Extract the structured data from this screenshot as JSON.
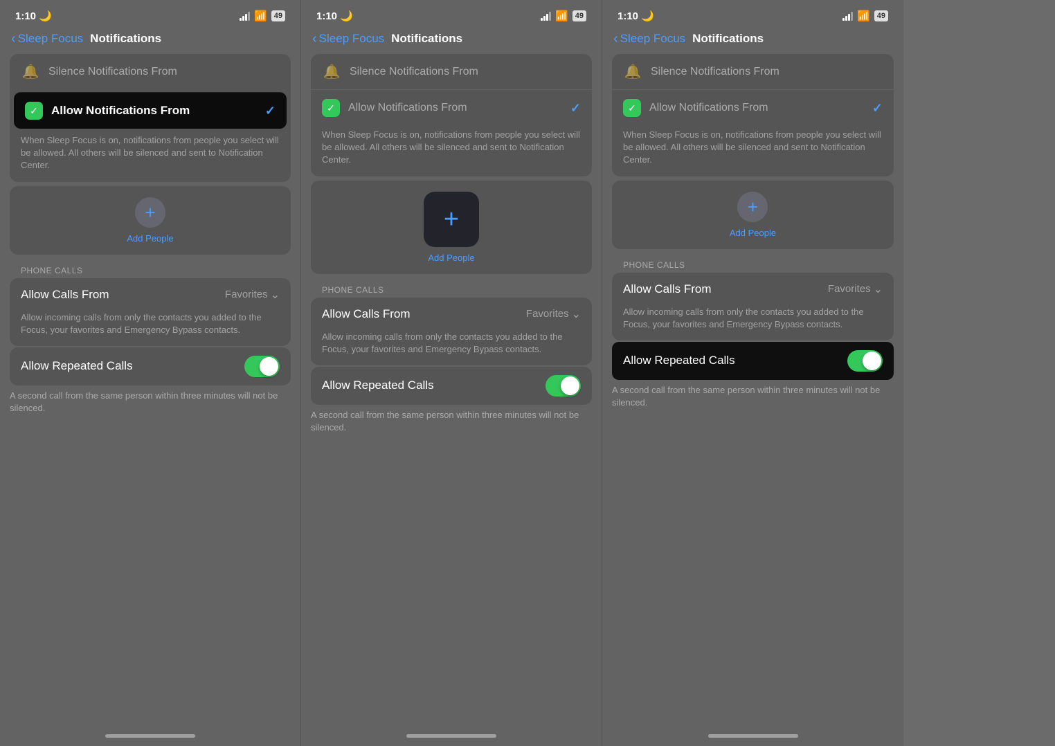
{
  "panels": [
    {
      "id": "panel-1",
      "statusBar": {
        "time": "1:10",
        "moonIcon": "🌙",
        "battery": "49"
      },
      "nav": {
        "backLabel": "Sleep Focus",
        "title": "Notifications"
      },
      "silenceLabel": "Silence Notifications From",
      "allowLabel": "Allow Notifications From",
      "allowSelected": true,
      "description": "When Sleep Focus is on, notifications from people you select will be allowed. All others will be silenced and sent to Notification Center.",
      "addPeopleLabel": "Add People",
      "addPeopleHighlighted": false,
      "phoneCallsHeader": "PHONE CALLS",
      "allowCallsLabel": "Allow Calls From",
      "allowCallsValue": "Favorites",
      "callsDescription": "Allow incoming calls from only the contacts you added to the Focus, your favorites and Emergency Bypass contacts.",
      "allowRepeatedLabel": "Allow Repeated Calls",
      "toggleOn": true,
      "toggleHighlighted": false,
      "repeatedDesc": "A second call from the same person within three minutes will not be silenced."
    },
    {
      "id": "panel-2",
      "statusBar": {
        "time": "1:10",
        "moonIcon": "🌙",
        "battery": "49"
      },
      "nav": {
        "backLabel": "Sleep Focus",
        "title": "Notifications"
      },
      "silenceLabel": "Silence Notifications From",
      "allowLabel": "Allow Notifications From",
      "allowSelected": false,
      "description": "When Sleep Focus is on, notifications from people you select will be allowed. All others will be silenced and sent to Notification Center.",
      "addPeopleLabel": "Add People",
      "addPeopleHighlighted": true,
      "phoneCallsHeader": "PHONE CALLS",
      "allowCallsLabel": "Allow Calls From",
      "allowCallsValue": "Favorites",
      "callsDescription": "Allow incoming calls from only the contacts you added to the Focus, your favorites and Emergency Bypass contacts.",
      "allowRepeatedLabel": "Allow Repeated Calls",
      "toggleOn": true,
      "toggleHighlighted": false,
      "repeatedDesc": "A second call from the same person within three minutes will not be silenced."
    },
    {
      "id": "panel-3",
      "statusBar": {
        "time": "1:10",
        "moonIcon": "🌙",
        "battery": "49"
      },
      "nav": {
        "backLabel": "Sleep Focus",
        "title": "Notifications"
      },
      "silenceLabel": "Silence Notifications From",
      "allowLabel": "Allow Notifications From",
      "allowSelected": false,
      "description": "When Sleep Focus is on, notifications from people you select will be allowed. All others will be silenced and sent to Notification Center.",
      "addPeopleLabel": "Add People",
      "addPeopleHighlighted": false,
      "phoneCallsHeader": "PHONE CALLS",
      "allowCallsLabel": "Allow Calls From",
      "allowCallsValue": "Favorites",
      "callsDescription": "Allow incoming calls from only the contacts you added to the Focus, your favorites and Emergency Bypass contacts.",
      "allowRepeatedLabel": "Allow Repeated Calls",
      "toggleOn": true,
      "toggleHighlighted": true,
      "repeatedDesc": "A second call from the same person within three minutes will not be silenced."
    }
  ],
  "icons": {
    "back": "‹",
    "check": "✓",
    "plus": "+",
    "chevronRight": "›"
  }
}
